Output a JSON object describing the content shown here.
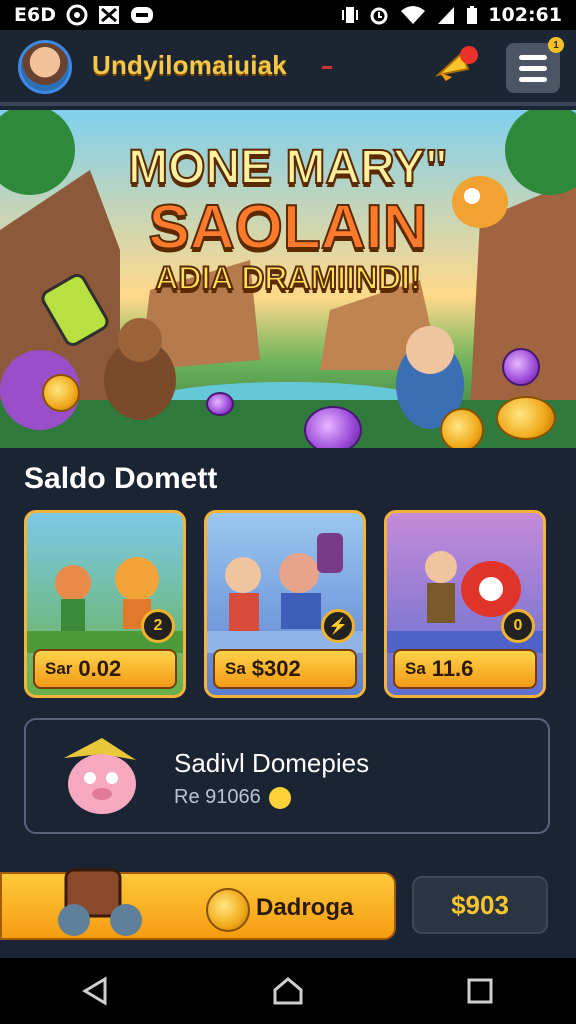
{
  "status_bar": {
    "left_text": "E6D",
    "time": "102:61"
  },
  "header": {
    "brand": "Undyilomaiuiak",
    "menu_badge": "1"
  },
  "banner": {
    "line1": "MONE MARY\"",
    "line2": "SAOLAIN",
    "line3": "ADIA DRAMIINDI!"
  },
  "section": {
    "title": "Saldo Domett"
  },
  "cards": [
    {
      "label": "Sar",
      "value": "0.02",
      "badge": "2"
    },
    {
      "label": "Sa",
      "value": "$302",
      "badge": ""
    },
    {
      "label": "Sa",
      "value": "11.6",
      "badge": "0"
    }
  ],
  "promo": {
    "title": "Sadivl Domepies",
    "subtitle": "Re 91066"
  },
  "action_button": {
    "label": "Dadroga"
  },
  "amount_button": {
    "label": "$903"
  },
  "colors": {
    "accent": "#f4c84a",
    "card_border": "#f2b43a",
    "background": "#1b2433"
  }
}
